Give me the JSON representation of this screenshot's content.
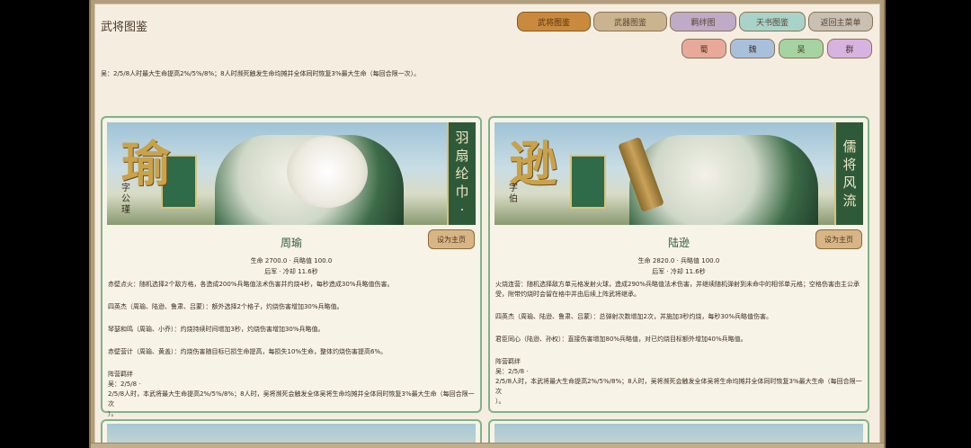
{
  "header": {
    "title": "武将图鉴"
  },
  "tabs": [
    {
      "label": "武将图鉴"
    },
    {
      "label": "武器图鉴"
    },
    {
      "label": "羁绊图"
    },
    {
      "label": "天书图鉴"
    },
    {
      "label": "返回主菜单"
    }
  ],
  "factions": [
    {
      "label": "蜀"
    },
    {
      "label": "魏"
    },
    {
      "label": "吴"
    },
    {
      "label": "群"
    }
  ],
  "summary": "吴：2/5/8人时最大生命提高2%/5%/8%；8人时濒死触发生命均摊并全体同时恢复3%最大生命（每回合限一次）。",
  "colors": {
    "accent_green": "#2f5a3a",
    "card_border": "#7fb28a",
    "active_tab": "#c98a3d"
  },
  "cards": [
    {
      "portrait": {
        "char": "瑜",
        "zi": "字公瑾",
        "side_title": [
          "羽",
          "扇",
          "纶",
          "巾",
          "·"
        ]
      },
      "set_home_label": "设为主页",
      "name": "周瑜",
      "stat_line1": "生命 2700.0 · 兵略值 100.0",
      "stat_line2": "后军 · 冷却 11.6秒",
      "skills": [
        "赤壁点火：随机选择2个敌方格，各造成200%兵略值法术伤害并灼烧4秒，每秒造成30%兵略值伤害。",
        "四英杰（周瑜、陆逊、鲁肃、吕蒙）：额外选择2个格子，灼烧伤害增加30%兵略值。",
        "琴瑟和鸣（周瑜、小乔）：灼烧持续时间增加3秒，灼烧伤害增加30%兵略值。",
        "赤壁营计（周瑜、黄盖）：灼烧伤害随目标已损生命提高，每损失10%生命，整体灼烧伤害提高6%。"
      ],
      "camp_title": "阵营羁绊",
      "camp_line1": "吴：2/5/8 ·",
      "camp_line2": "2/5/8人时，本武将最大生命提高2%/5%/8%；8人时，吴将濒死会触发全体吴将生命均摊并全体同时恢复3%最大生命（每回合限一次",
      "camp_line3": "）。"
    },
    {
      "portrait": {
        "char": "逊",
        "zi": "字伯",
        "side_title": [
          "儒",
          "将",
          "风",
          "流"
        ]
      },
      "set_home_label": "设为主页",
      "name": "陆逊",
      "stat_line1": "生命 2820.0 · 兵略值 100.0",
      "stat_line2": "后军 · 冷却 11.6秒",
      "skills": [
        "火烧连营：随机选择敌方单元格发射火球，造成290%兵略值法术伤害，并继续随机弹射到未命中的相邻单元格；空格伤害由主公承受，附带灼烧时会留在格中并由后续上阵武将继承。",
        "四英杰（周瑜、陆逊、鲁肃、吕蒙）：总弹射次数增加2次，并施加3秒灼烧，每秒30%兵略值伤害。",
        "君臣同心（陆逊、孙权）：直接伤害增加80%兵略值，对已灼烧目标额外增加40%兵略值。"
      ],
      "camp_title": "阵营羁绊",
      "camp_line1": "吴：2/5/8 ·",
      "camp_line2": "2/5/8人时，本武将最大生命提高2%/5%/8%；8人时，吴将濒死会触发全体吴将生命均摊并全体同时恢复3%最大生命（每回合限一次",
      "camp_line3": "）。"
    }
  ]
}
